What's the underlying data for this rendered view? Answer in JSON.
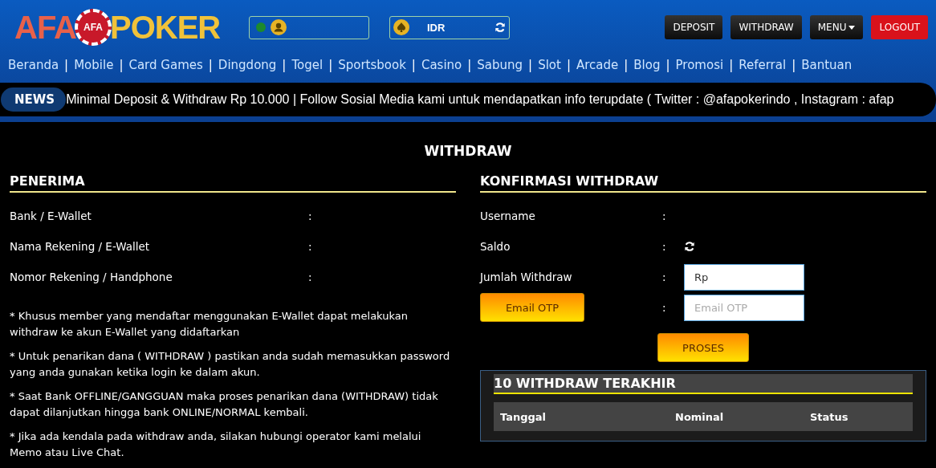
{
  "logo": {
    "left": "AFA",
    "chip": "AFA",
    "right": "POKER"
  },
  "user_box": {
    "status_online": true
  },
  "currency_box": {
    "currency": "IDR"
  },
  "header_buttons": [
    {
      "label": "DEPOSIT",
      "kind": "plain"
    },
    {
      "label": "WITHDRAW",
      "kind": "plain"
    },
    {
      "label": "MENU",
      "kind": "dropdown"
    },
    {
      "label": "LOGOUT",
      "kind": "danger"
    }
  ],
  "nav": {
    "separator": "|",
    "items": [
      "Beranda",
      "Mobile",
      "Card Games",
      "Dingdong",
      "Togel",
      "Sportsbook",
      "Casino",
      "Sabung",
      "Slot",
      "Arcade",
      "Blog",
      "Promosi",
      "Referral",
      "Bantuan"
    ]
  },
  "news": {
    "label": "NEWS",
    "text": "Minimal Deposit & Withdraw Rp 10.000 | Follow Sosial Media kami untuk mendapatkan info terupdate ( Twitter : @afapokerindo , Instagram : afap"
  },
  "page_title": "WITHDRAW",
  "penerima": {
    "title": "PENERIMA",
    "separator": ":",
    "fields": [
      "Bank / E-Wallet",
      "Nama Rekening / E-Wallet",
      "Nomor Rekening / Handphone"
    ],
    "notes": [
      "* Khusus member yang mendaftar menggunakan E-Wallet dapat melakukan withdraw ke akun E-Wallet yang didaftarkan",
      "* Untuk penarikan dana ( WITHDRAW ) pastikan anda sudah memasukkan password yang anda gunakan ketika login ke dalam akun.",
      "* Saat Bank OFFLINE/GANGGUAN maka proses penarikan dana (WITHDRAW) tidak dapat dilanjutkan hingga bank ONLINE/NORMAL kembali.",
      "* Jika ada kendala pada withdraw anda, silakan hubungi operator kami melalui Memo atau Live Chat."
    ]
  },
  "konfirmasi": {
    "title": "KONFIRMASI WITHDRAW",
    "separator": ":",
    "rows": [
      {
        "kind": "text",
        "label": "Username"
      },
      {
        "kind": "balance",
        "label": "Saldo"
      },
      {
        "kind": "input",
        "label": "Jumlah Withdraw",
        "value": "Rp"
      },
      {
        "kind": "otp",
        "label": "Email OTP",
        "placeholder": "Email OTP"
      }
    ],
    "submit": "PROSES"
  },
  "history": {
    "title": "10 WITHDRAW TERAKHIR",
    "columns": [
      "Tanggal",
      "Nominal",
      "Status"
    ]
  }
}
